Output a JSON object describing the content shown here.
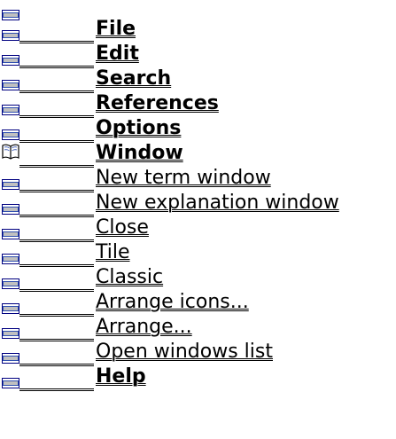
{
  "icons": {
    "folder": "folder-closed-icon",
    "book": "open-book-icon"
  },
  "colors": {
    "icon_fill": "#c0c0c0",
    "icon_dark": "#3050b0",
    "text": "#000000"
  },
  "menu": {
    "items": [
      {
        "label": "File",
        "bold": true,
        "icon": "folder"
      },
      {
        "label": "Edit",
        "bold": true,
        "icon": "folder"
      },
      {
        "label": "Search",
        "bold": true,
        "icon": "folder"
      },
      {
        "label": "References",
        "bold": true,
        "icon": "folder"
      },
      {
        "label": "Options",
        "bold": true,
        "icon": "folder"
      },
      {
        "label": "Window",
        "bold": true,
        "icon": "book"
      },
      {
        "label": "New term window",
        "bold": false,
        "icon": "folder"
      },
      {
        "label": "New explanation window",
        "bold": false,
        "icon": "folder"
      },
      {
        "label": "Close",
        "bold": false,
        "icon": "folder"
      },
      {
        "label": "Tile",
        "bold": false,
        "icon": "folder"
      },
      {
        "label": "Classic",
        "bold": false,
        "icon": "folder"
      },
      {
        "label": "Arrange icons...",
        "bold": false,
        "icon": "folder"
      },
      {
        "label": "Arrange...",
        "bold": false,
        "icon": "folder"
      },
      {
        "label": "Open windows list",
        "bold": false,
        "icon": "folder"
      },
      {
        "label": "Help",
        "bold": true,
        "icon": "folder"
      }
    ]
  }
}
